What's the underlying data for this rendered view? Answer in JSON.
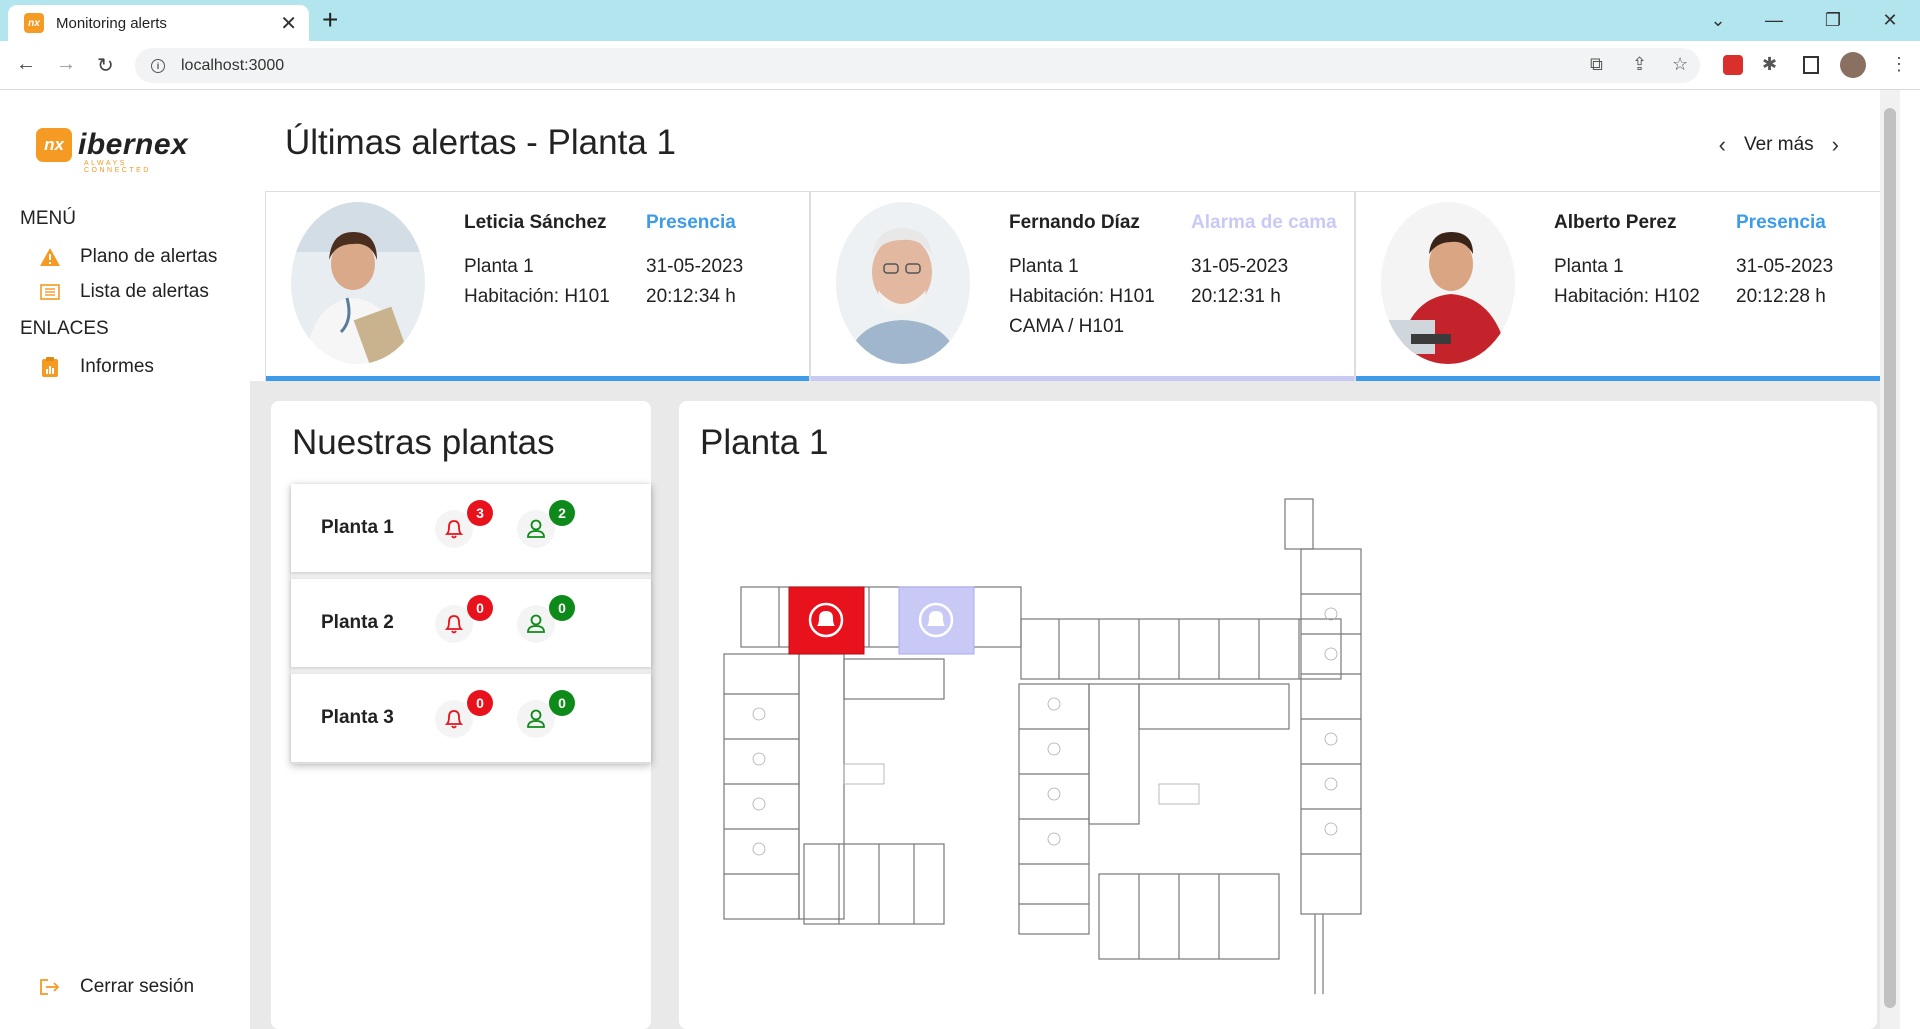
{
  "browser": {
    "tab_title": "Monitoring alerts",
    "url": "localhost:3000"
  },
  "sidebar": {
    "logo_text": "ibernex",
    "logo_tagline": "ALWAYS CONNECTED",
    "menu_header": "MENÚ",
    "menu_items": [
      {
        "label": "Plano de alertas",
        "icon": "warning-icon"
      },
      {
        "label": "Lista de alertas",
        "icon": "list-icon"
      }
    ],
    "links_header": "ENLACES",
    "link_items": [
      {
        "label": "Informes",
        "icon": "report-icon"
      }
    ],
    "logout_label": "Cerrar sesión"
  },
  "header": {
    "title": "Últimas alertas - Planta 1",
    "more_label": "Ver más"
  },
  "alerts": [
    {
      "name": "Leticia Sánchez",
      "type": "Presencia",
      "type_color": "#3d9be9",
      "floor": "Planta 1",
      "room": "Habitación: H101",
      "extra": "",
      "date": "31-05-2023",
      "time": "20:12:34 h",
      "bar_color": "#3d9be9"
    },
    {
      "name": "Fernando Díaz",
      "type": "Alarma de cama",
      "type_color": "#c9c9f5",
      "floor": "Planta 1",
      "room": "Habitación: H101",
      "extra": "CAMA / H101",
      "date": "31-05-2023",
      "time": "20:12:31 h",
      "bar_color": "#c9c9f5"
    },
    {
      "name": "Alberto Perez",
      "type": "Presencia",
      "type_color": "#3d9be9",
      "floor": "Planta 1",
      "room": "Habitación: H102",
      "extra": "",
      "date": "31-05-2023",
      "time": "20:12:28 h",
      "bar_color": "#3d9be9"
    }
  ],
  "plants_panel": {
    "title": "Nuestras plantas",
    "plants": [
      {
        "name": "Planta 1",
        "alerts": "3",
        "people": "2"
      },
      {
        "name": "Planta 2",
        "alerts": "0",
        "people": "0"
      },
      {
        "name": "Planta 3",
        "alerts": "0",
        "people": "0"
      }
    ]
  },
  "map_panel": {
    "title": "Planta 1"
  },
  "colors": {
    "accent": "#f59a23",
    "alert_red": "#e8121c",
    "people_green": "#0d8a1a",
    "presence_blue": "#3d9be9",
    "bed_alarm_lavender": "#c9c9f5"
  }
}
